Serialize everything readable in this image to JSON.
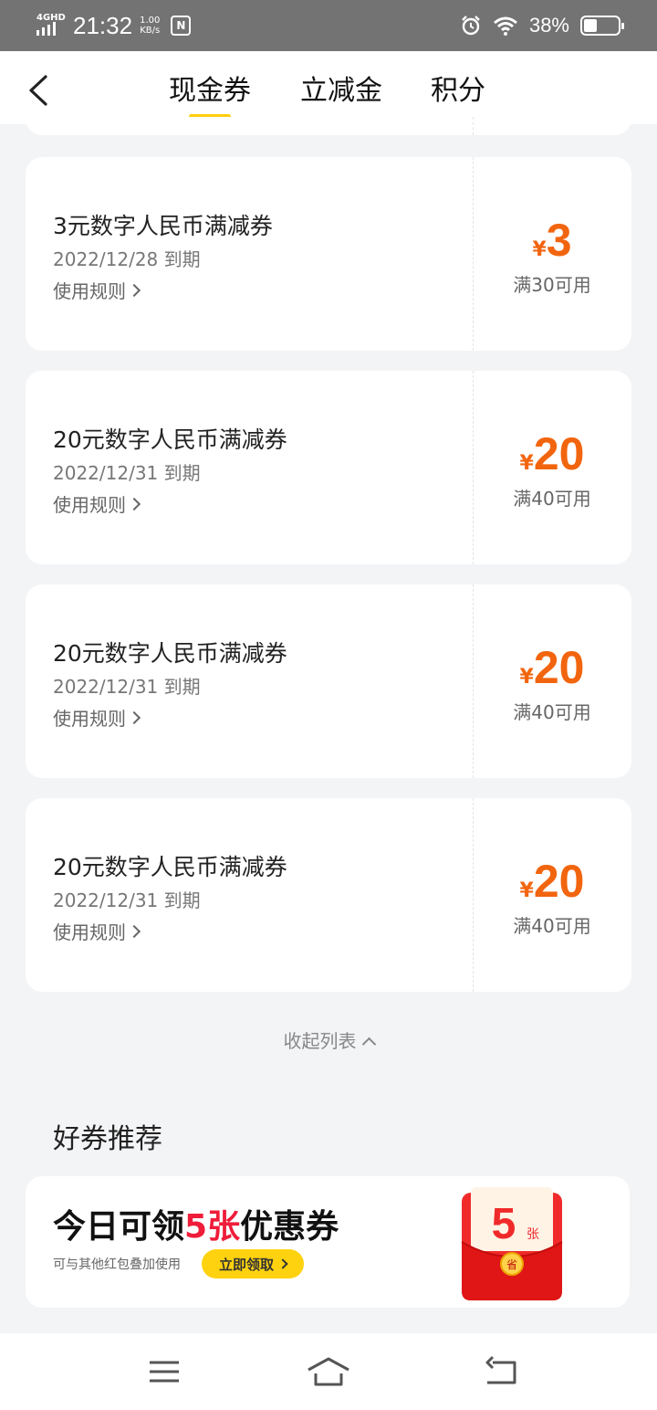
{
  "status_bar": {
    "network": "4GHD",
    "time": "21:32",
    "speed_value": "1.00",
    "speed_unit": "KB/s",
    "nfc": "N",
    "battery": "38%",
    "battery_level": 0.38
  },
  "header": {
    "tabs": [
      {
        "label": "现金券",
        "active": true
      },
      {
        "label": "立减金",
        "active": false
      },
      {
        "label": "积分",
        "active": false
      }
    ]
  },
  "coupons": [
    {
      "title": "3元数字人民币满减券",
      "date": "2022/12/28 到期",
      "rule": "使用规则",
      "currency": "¥",
      "amount": "3",
      "condition": "满30可用"
    },
    {
      "title": "20元数字人民币满减券",
      "date": "2022/12/31 到期",
      "rule": "使用规则",
      "currency": "¥",
      "amount": "20",
      "condition": "满40可用"
    },
    {
      "title": "20元数字人民币满减券",
      "date": "2022/12/31 到期",
      "rule": "使用规则",
      "currency": "¥",
      "amount": "20",
      "condition": "满40可用"
    },
    {
      "title": "20元数字人民币满减券",
      "date": "2022/12/31 到期",
      "rule": "使用规则",
      "currency": "¥",
      "amount": "20",
      "condition": "满40可用"
    }
  ],
  "collapse_label": "收起列表",
  "recommend": {
    "title": "好券推荐",
    "promo_prefix": "今日可领",
    "promo_highlight": "5张",
    "promo_suffix": "优惠券",
    "promo_sub": "可与其他红包叠加使用",
    "promo_button": "立即领取",
    "envelope_number": "5",
    "envelope_unit": "张",
    "envelope_seal": "省"
  },
  "colors": {
    "accent_yellow": "#ffcf0f",
    "amount_orange": "#f2650f",
    "promo_red": "#ef1d3a"
  }
}
